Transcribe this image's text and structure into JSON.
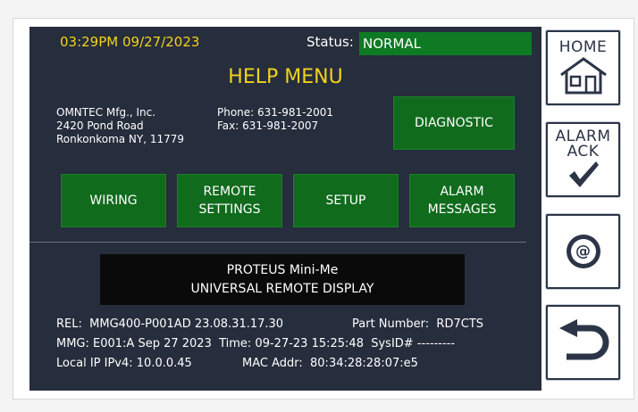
{
  "header": {
    "clock": "03:29PM 09/27/2023",
    "status_label": "Status:",
    "status_value": "NORMAL"
  },
  "title": "HELP MENU",
  "company": {
    "name": "OMNTEC Mfg., Inc.",
    "address1": "2420 Pond Road",
    "address2": "Ronkonkoma NY, 11779",
    "phone": "Phone: 631-981-2001",
    "fax": "Fax: 631-981-2007"
  },
  "buttons": {
    "diagnostic": "DIAGNOSTIC",
    "wiring": "WIRING",
    "remote_settings_1": "REMOTE",
    "remote_settings_2": "SETTINGS",
    "setup": "SETUP",
    "alarm_messages_1": "ALARM",
    "alarm_messages_2": "MESSAGES"
  },
  "product": {
    "line1": "PROTEUS Mini-Me",
    "line2": "UNIVERSAL REMOTE DISPLAY"
  },
  "info": {
    "rel": "REL:  MMG400-P001AD 23.08.31.17.30",
    "part_number": "Part Number:  RD7CTS",
    "mmg": "MMG: E001:A Sep 27 2023  Time: 09-27-23 15:25:48  SysID# ---------",
    "ip": "Local IP IPv4: 10.0.0.45",
    "mac": "MAC Addr:  80:34:28:28:07:e5"
  },
  "side": {
    "home_label": "HOME",
    "alarm_ack_1": "ALARM",
    "alarm_ack_2": "ACK",
    "at_symbol": "@"
  },
  "colors": {
    "screen_bg": "#262d3c",
    "accent_yellow": "#f2d21c",
    "button_green": "#116b1d",
    "status_green": "#0e7a24"
  }
}
